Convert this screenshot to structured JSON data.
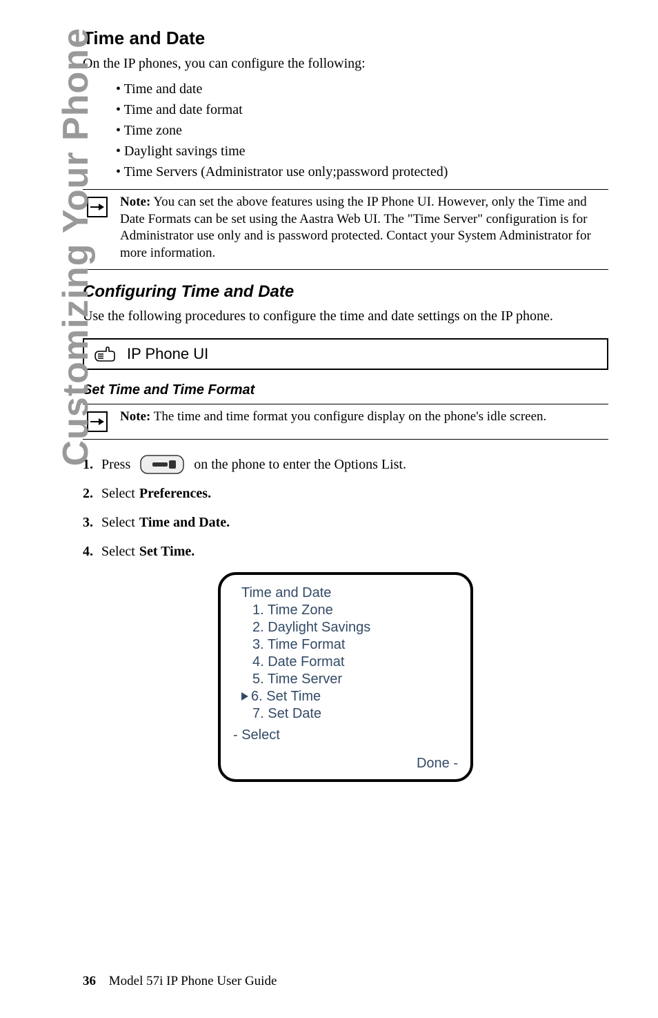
{
  "sidebar": {
    "vertical_title": "Customizing Your Phone"
  },
  "section": {
    "title": "Time and Date",
    "intro": "On the IP phones, you can configure the following:",
    "bullets": [
      "Time and date",
      "Time and date format",
      "Time zone",
      "Daylight savings time",
      "Time Servers (Administrator use only;password protected)"
    ]
  },
  "note1": {
    "label": "Note:",
    "text": "You can set the above features using the IP Phone UI. However, only the Time and Date Formats can be set using the Aastra Web UI. The \"Time Server\" configuration is for Administrator use only and is password protected. Contact your System Administrator for more information."
  },
  "subsection": {
    "title": "Configuring Time and Date",
    "body": "Use the following procedures to configure the time and date settings on the IP phone."
  },
  "callout": {
    "label": "IP Phone UI"
  },
  "subsub": {
    "title": "Set Time and Time Format"
  },
  "note2": {
    "label": "Note:",
    "text": "The time and time format you configure display on the phone's idle screen."
  },
  "steps": [
    {
      "num": "1.",
      "pre": "Press",
      "post": "on the phone to enter the Options List."
    },
    {
      "num": "2.",
      "pre": "Select",
      "bold": "Preferences."
    },
    {
      "num": "3.",
      "pre": "Select",
      "bold": "Time and Date."
    },
    {
      "num": "4.",
      "pre": "Select",
      "bold": "Set Time."
    }
  ],
  "phone_screen": {
    "title": "Time and Date",
    "items": [
      "1. Time Zone",
      "2. Daylight Savings",
      "3. Time Format",
      "4. Date Format",
      "5. Time Server",
      "6. Set Time",
      "7. Set Date"
    ],
    "cursor_index": 5,
    "select": "- Select",
    "done": "Done -"
  },
  "footer": {
    "page": "36",
    "title": "Model 57i IP Phone User Guide"
  }
}
